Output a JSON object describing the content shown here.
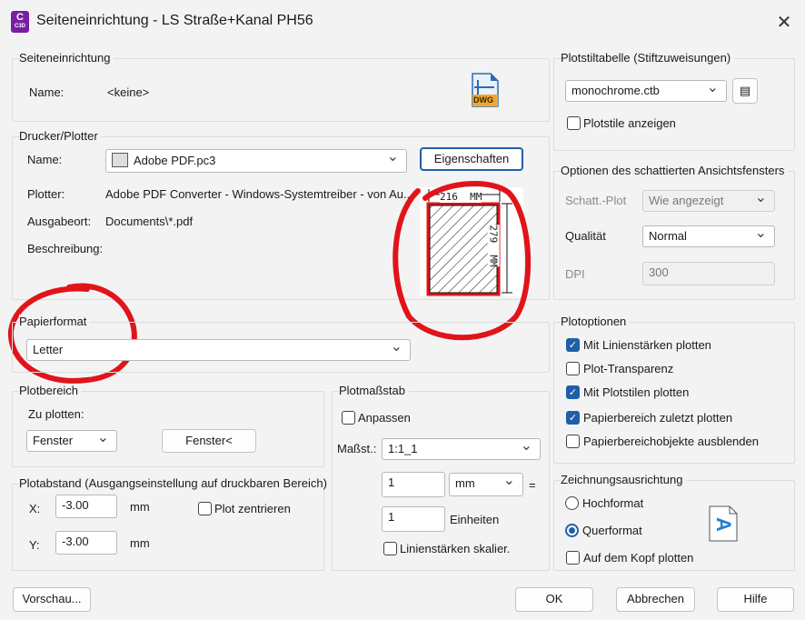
{
  "window": {
    "title": "Seiteneinrichtung - LS Straße+Kanal PH56",
    "app_icon": "C",
    "app_icon_sub": "C3D"
  },
  "seiteneinrichtung": {
    "label": "Seiteneinrichtung",
    "name_label": "Name:",
    "name_value": "<keine>",
    "dwg_badge": "DWG"
  },
  "drucker": {
    "label": "Drucker/Plotter",
    "name_label": "Name:",
    "name_value": "Adobe PDF.pc3",
    "properties_button": "Eigenschaften",
    "plotter_label": "Plotter:",
    "plotter_value": "Adobe PDF Converter - Windows-Systemtreiber - von Au...",
    "ausgabeort_label": "Ausgabeort:",
    "ausgabeort_value": "Documents\\*.pdf",
    "beschreibung_label": "Beschreibung:",
    "preview_width": "216  MM",
    "preview_height": "279  MM"
  },
  "papierformat": {
    "label": "Papierformat",
    "value": "Letter"
  },
  "plotbereich": {
    "label": "Plotbereich",
    "zu_plotten_label": "Zu plotten:",
    "zu_plotten_value": "Fenster",
    "window_button": "Fenster<"
  },
  "plotabstand": {
    "label": "Plotabstand (Ausgangseinstellung auf druckbaren Bereich)",
    "x_label": "X:",
    "x_value": "-3.00",
    "x_unit": "mm",
    "y_label": "Y:",
    "y_value": "-3.00",
    "y_unit": "mm",
    "center_label": "Plot zentrieren"
  },
  "plotmassstab": {
    "label": "Plotmaßstab",
    "fit_label": "Anpassen",
    "scale_label": "Maßst.:",
    "scale_value": "1:1_1",
    "value1": "1",
    "unit1": "mm",
    "equals": "=",
    "value2": "1",
    "unit2": "Einheiten",
    "lineweights_label": "Linienstärken skalier."
  },
  "plotstil": {
    "label": "Plotstiltabelle (Stiftzuweisungen)",
    "value": "monochrome.ctb",
    "show_label": "Plotstile anzeigen"
  },
  "schattiert": {
    "label": "Optionen des schattierten Ansichtsfensters",
    "schatt_label": "Schatt.-Plot",
    "schatt_value": "Wie angezeigt",
    "quality_label": "Qualität",
    "quality_value": "Normal",
    "dpi_label": "DPI",
    "dpi_value": "300"
  },
  "plotoptionen": {
    "label": "Plotoptionen",
    "items": [
      "Mit Linienstärken plotten",
      "Plot-Transparenz",
      "Mit Plotstilen plotten",
      "Papierbereich zuletzt plotten",
      "Papierbereichobjekte ausblenden"
    ]
  },
  "ausrichtung": {
    "label": "Zeichnungsausrichtung",
    "hoch": "Hochformat",
    "quer": "Querformat",
    "kopf": "Auf dem Kopf plotten",
    "orientation_glyph": "A"
  },
  "footer": {
    "preview": "Vorschau...",
    "ok": "OK",
    "cancel": "Abbrechen",
    "help": "Hilfe"
  },
  "colors": {
    "accent": "#1f5fa8",
    "annotation": "#e0141a"
  }
}
